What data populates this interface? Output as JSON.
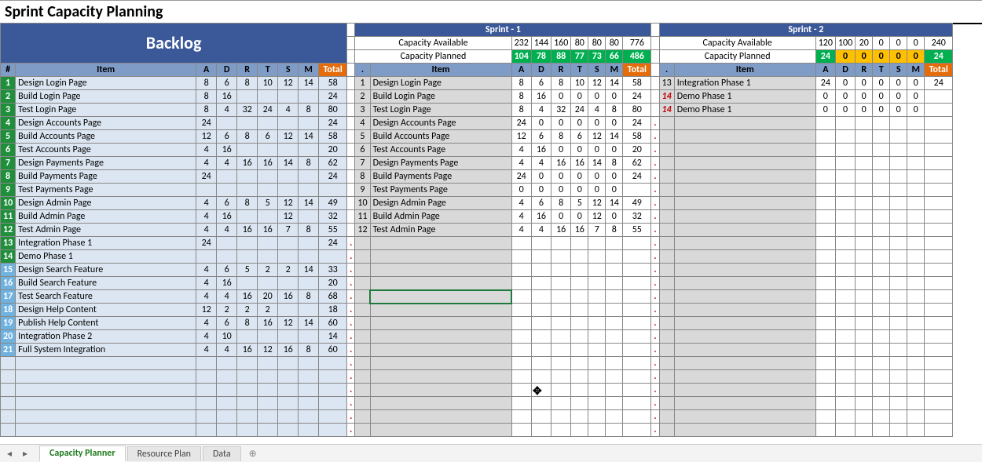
{
  "title": "Sprint Capacity Planning",
  "tabs": {
    "active": "Capacity Planner",
    "others": [
      "Resource Plan",
      "Data"
    ]
  },
  "backlog": {
    "header": "Backlog",
    "columns": [
      "#",
      "Item",
      "A",
      "D",
      "R",
      "T",
      "S",
      "M",
      "Total"
    ],
    "rows": [
      {
        "n": 1,
        "item": "Design Login Page",
        "a": 8,
        "d": 6,
        "r": 8,
        "t": 10,
        "s": 12,
        "m": 14,
        "total": 58,
        "high": true
      },
      {
        "n": 2,
        "item": "Build Login Page",
        "a": 8,
        "d": 16,
        "r": "",
        "t": "",
        "s": "",
        "m": "",
        "total": 24,
        "high": true
      },
      {
        "n": 3,
        "item": "Test Login Page",
        "a": 8,
        "d": 4,
        "r": 32,
        "t": 24,
        "s": 4,
        "m": 8,
        "total": 80,
        "high": true
      },
      {
        "n": 4,
        "item": "Design Accounts Page",
        "a": 24,
        "d": "",
        "r": "",
        "t": "",
        "s": "",
        "m": "",
        "total": 24,
        "high": true
      },
      {
        "n": 5,
        "item": "Build Accounts Page",
        "a": 12,
        "d": 6,
        "r": 8,
        "t": 6,
        "s": 12,
        "m": 14,
        "total": 58,
        "high": true
      },
      {
        "n": 6,
        "item": "Test Accounts Page",
        "a": 4,
        "d": 16,
        "r": "",
        "t": "",
        "s": "",
        "m": "",
        "total": 20,
        "high": true
      },
      {
        "n": 7,
        "item": "Design Payments Page",
        "a": 4,
        "d": 4,
        "r": 16,
        "t": 16,
        "s": 14,
        "m": 8,
        "total": 62,
        "high": true
      },
      {
        "n": 8,
        "item": "Build Payments Page",
        "a": 24,
        "d": "",
        "r": "",
        "t": "",
        "s": "",
        "m": "",
        "total": 24,
        "high": true
      },
      {
        "n": 9,
        "item": "Test Payments Page",
        "a": "",
        "d": "",
        "r": "",
        "t": "",
        "s": "",
        "m": "",
        "total": "",
        "high": true
      },
      {
        "n": 10,
        "item": "Design Admin Page",
        "a": 4,
        "d": 6,
        "r": 8,
        "t": 5,
        "s": 12,
        "m": 14,
        "total": 49,
        "high": true
      },
      {
        "n": 11,
        "item": "Build Admin Page",
        "a": 4,
        "d": 16,
        "r": "",
        "t": "",
        "s": 12,
        "m": "",
        "total": 32,
        "high": true
      },
      {
        "n": 12,
        "item": "Test Admin Page",
        "a": 4,
        "d": 4,
        "r": 16,
        "t": 16,
        "s": 7,
        "m": 8,
        "total": 55,
        "high": true
      },
      {
        "n": 13,
        "item": "Integration Phase 1",
        "a": 24,
        "d": "",
        "r": "",
        "t": "",
        "s": "",
        "m": "",
        "total": 24,
        "high": true
      },
      {
        "n": 14,
        "item": "Demo Phase 1",
        "a": "",
        "d": "",
        "r": "",
        "t": "",
        "s": "",
        "m": "",
        "total": "",
        "high": true
      },
      {
        "n": 15,
        "item": "Design Search Feature",
        "a": 4,
        "d": 6,
        "r": 5,
        "t": 2,
        "s": 2,
        "m": 14,
        "total": 33
      },
      {
        "n": 16,
        "item": "Build Search Feature",
        "a": 4,
        "d": 16,
        "r": "",
        "t": "",
        "s": "",
        "m": "",
        "total": 20
      },
      {
        "n": 17,
        "item": "Test Search Feature",
        "a": 4,
        "d": 4,
        "r": 16,
        "t": 20,
        "s": 16,
        "m": 8,
        "total": 68
      },
      {
        "n": 18,
        "item": "Design Help Content",
        "a": 12,
        "d": 2,
        "r": 2,
        "t": 2,
        "s": "",
        "m": "",
        "total": 18
      },
      {
        "n": 19,
        "item": "Publish Help Content",
        "a": 4,
        "d": 6,
        "r": 8,
        "t": 16,
        "s": 12,
        "m": 14,
        "total": 60
      },
      {
        "n": 20,
        "item": "Integration Phase 2",
        "a": 4,
        "d": 10,
        "r": "",
        "t": "",
        "s": "",
        "m": "",
        "total": 14
      },
      {
        "n": 21,
        "item": "Full System Integration",
        "a": 4,
        "d": 4,
        "r": 16,
        "t": 12,
        "s": 16,
        "m": 8,
        "total": 60
      }
    ]
  },
  "sprint1": {
    "header": "Sprint - 1",
    "capacityAvailableLabel": "Capacity Available",
    "capacityPlannedLabel": "Capacity Planned",
    "capAvail": [
      232,
      144,
      160,
      80,
      80,
      80,
      776
    ],
    "capPlan": [
      104,
      78,
      88,
      77,
      73,
      66,
      486
    ],
    "columns": [
      ".",
      "Item",
      "A",
      "D",
      "R",
      "T",
      "S",
      "M",
      "Total"
    ],
    "rows": [
      {
        "n": 1,
        "item": "Design Login Page",
        "a": 8,
        "d": 6,
        "r": 8,
        "t": 10,
        "s": 12,
        "m": 14,
        "total": 58
      },
      {
        "n": 2,
        "item": "Build Login Page",
        "a": 8,
        "d": 16,
        "r": 0,
        "t": 0,
        "s": 0,
        "m": 0,
        "total": 24
      },
      {
        "n": 3,
        "item": "Test Login Page",
        "a": 8,
        "d": 4,
        "r": 32,
        "t": 24,
        "s": 4,
        "m": 8,
        "total": 80
      },
      {
        "n": 4,
        "item": "Design Accounts Page",
        "a": 24,
        "d": 0,
        "r": 0,
        "t": 0,
        "s": 0,
        "m": 0,
        "total": 24
      },
      {
        "n": 5,
        "item": "Build Accounts Page",
        "a": 12,
        "d": 6,
        "r": 8,
        "t": 6,
        "s": 12,
        "m": 14,
        "total": 58
      },
      {
        "n": 6,
        "item": "Test Accounts Page",
        "a": 4,
        "d": 16,
        "r": 0,
        "t": 0,
        "s": 0,
        "m": 0,
        "total": 20
      },
      {
        "n": 7,
        "item": "Design Payments Page",
        "a": 4,
        "d": 4,
        "r": 16,
        "t": 16,
        "s": 14,
        "m": 8,
        "total": 62
      },
      {
        "n": 8,
        "item": "Build Payments Page",
        "a": 24,
        "d": 0,
        "r": 0,
        "t": 0,
        "s": 0,
        "m": 0,
        "total": 24
      },
      {
        "n": 9,
        "item": "Test Payments Page",
        "a": 0,
        "d": 0,
        "r": 0,
        "t": 0,
        "s": 0,
        "m": 0,
        "total": ""
      },
      {
        "n": 10,
        "item": "Design Admin Page",
        "a": 4,
        "d": 6,
        "r": 8,
        "t": 5,
        "s": 12,
        "m": 14,
        "total": 49
      },
      {
        "n": 11,
        "item": "Build Admin Page",
        "a": 4,
        "d": 16,
        "r": 0,
        "t": 0,
        "s": 12,
        "m": 0,
        "total": 32
      },
      {
        "n": 12,
        "item": "Test Admin Page",
        "a": 4,
        "d": 4,
        "r": 16,
        "t": 16,
        "s": 7,
        "m": 8,
        "total": 55
      }
    ]
  },
  "sprint2": {
    "header": "Sprint - 2",
    "capacityAvailableLabel": "Capacity Available",
    "capacityPlannedLabel": "Capacity Planned",
    "capAvail": [
      120,
      100,
      20,
      0,
      0,
      0,
      240
    ],
    "capPlan": [
      24,
      0,
      0,
      0,
      0,
      0,
      24
    ],
    "columns": [
      ".",
      "Item",
      "A",
      "D",
      "R",
      "T",
      "S",
      "M",
      "Total"
    ],
    "rows": [
      {
        "n": 13,
        "item": "Integration Phase 1",
        "a": 24,
        "d": 0,
        "r": 0,
        "t": 0,
        "s": 0,
        "m": 0,
        "total": 24
      },
      {
        "n": 14,
        "item": "Demo Phase 1",
        "a": 0,
        "d": 0,
        "r": 0,
        "t": 0,
        "s": 0,
        "m": 0,
        "total": "",
        "red": true
      },
      {
        "n": 14,
        "item": "Demo Phase 1",
        "a": 0,
        "d": 0,
        "r": 0,
        "t": 0,
        "s": 0,
        "m": 0,
        "total": "",
        "red": true
      }
    ]
  },
  "colors": {
    "blueHeader": "#3b5998",
    "blueHeaderText": "#ffffff",
    "subHeader": "#7f9cc7",
    "rowAlt": "#dce6f2",
    "numCol": "#1f8f3b",
    "numColLight": "#6fb2e0",
    "totalHeader": "#e46c0a",
    "greenCell": "#00b050",
    "orangeCell": "#ffc000",
    "ltGrey": "#e8e8e8"
  }
}
